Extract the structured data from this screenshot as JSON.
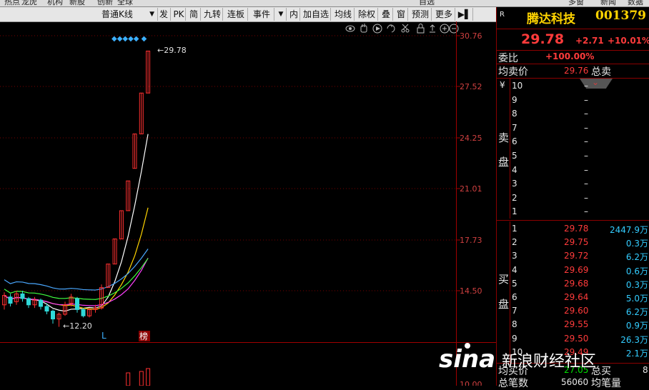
{
  "top_menu": [
    "热点",
    "龙虎",
    "机构",
    "新股",
    "创新",
    "全球",
    "",
    "",
    "",
    "",
    "",
    "",
    "自选",
    "",
    "",
    "",
    "",
    "",
    "",
    "多窗",
    "",
    "新闻",
    "",
    "数据"
  ],
  "toolbar": {
    "period_select": "普通K线",
    "buttons": [
      "发",
      "PK",
      "简",
      "九转",
      "连板",
      "事件",
      "内",
      "加自选",
      "均线",
      "除权",
      "叠",
      "窗",
      "预测",
      "更多"
    ]
  },
  "chart": {
    "y_ticks": [
      "30.76",
      "27.52",
      "24.25",
      "21.01",
      "17.73",
      "14.50"
    ],
    "bottom_tick": "10.00",
    "high_label": "29.78",
    "low_label": "12.20",
    "marker_L": "L",
    "marker_bang": "榜",
    "diamonds": "◆◆◆◆◆ ◆"
  },
  "candles": [
    {
      "o": 13.6,
      "c": 14.2,
      "h": 14.4,
      "l": 13.3
    },
    {
      "o": 14.1,
      "c": 13.7,
      "h": 14.3,
      "l": 13.5
    },
    {
      "o": 13.8,
      "c": 14.3,
      "h": 14.5,
      "l": 13.6
    },
    {
      "o": 14.3,
      "c": 14.0,
      "h": 14.5,
      "l": 13.8
    },
    {
      "o": 14.0,
      "c": 13.6,
      "h": 14.1,
      "l": 13.4
    },
    {
      "o": 13.6,
      "c": 13.9,
      "h": 14.1,
      "l": 13.4
    },
    {
      "o": 13.9,
      "c": 13.5,
      "h": 14.0,
      "l": 13.3
    },
    {
      "o": 13.5,
      "c": 13.2,
      "h": 13.7,
      "l": 13.0
    },
    {
      "o": 13.2,
      "c": 12.7,
      "h": 13.3,
      "l": 12.4
    },
    {
      "o": 12.7,
      "c": 13.0,
      "h": 13.1,
      "l": 12.2
    },
    {
      "o": 13.0,
      "c": 13.6,
      "h": 13.8,
      "l": 12.9
    },
    {
      "o": 13.7,
      "c": 14.1,
      "h": 14.3,
      "l": 13.5
    },
    {
      "o": 14.0,
      "c": 13.3,
      "h": 14.1,
      "l": 13.1
    },
    {
      "o": 13.3,
      "c": 12.9,
      "h": 13.4,
      "l": 12.8
    },
    {
      "o": 12.9,
      "c": 13.3,
      "h": 13.4,
      "l": 12.8
    },
    {
      "o": 13.3,
      "c": 13.4,
      "h": 13.6,
      "l": 13.1
    },
    {
      "o": 13.4,
      "c": 14.7,
      "h": 14.9,
      "l": 13.3
    },
    {
      "o": 14.7,
      "c": 16.2,
      "h": 16.2,
      "l": 14.7
    },
    {
      "o": 16.2,
      "c": 17.8,
      "h": 17.8,
      "l": 16.2
    },
    {
      "o": 17.8,
      "c": 19.6,
      "h": 19.6,
      "l": 17.8
    },
    {
      "o": 19.6,
      "c": 21.5,
      "h": 21.5,
      "l": 19.6
    },
    {
      "o": 22.3,
      "c": 24.5,
      "h": 24.5,
      "l": 22.3
    },
    {
      "o": 24.5,
      "c": 27.1,
      "h": 27.1,
      "l": 24.5
    },
    {
      "o": 27.1,
      "c": 29.78,
      "h": 29.78,
      "l": 27.1
    }
  ],
  "quote": {
    "r_label": "R",
    "name": "腾达科技",
    "code": "001379",
    "price": "29.78",
    "change": "+2.71",
    "change_pct": "+10.01%",
    "weibi_label": "委比",
    "weibi_value": "+100.00%",
    "avg_sell_label": "均卖价",
    "avg_sell_value": "29.76",
    "total_sell_label": "总卖",
    "sell_label_1": "卖",
    "sell_label_2": "盘",
    "yen": "¥",
    "sell_levels": [
      {
        "lvl": "10",
        "price": "–"
      },
      {
        "lvl": "9",
        "price": "–"
      },
      {
        "lvl": "8",
        "price": "–"
      },
      {
        "lvl": "7",
        "price": "–"
      },
      {
        "lvl": "6",
        "price": "–"
      },
      {
        "lvl": "5",
        "price": "–"
      },
      {
        "lvl": "4",
        "price": "–"
      },
      {
        "lvl": "3",
        "price": "–"
      },
      {
        "lvl": "2",
        "price": "–"
      },
      {
        "lvl": "1",
        "price": "–"
      }
    ],
    "buy_label_1": "买",
    "buy_label_2": "盘",
    "buy_levels": [
      {
        "lvl": "1",
        "price": "29.78",
        "vol": "2447.9万"
      },
      {
        "lvl": "2",
        "price": "29.75",
        "vol": "0.3万"
      },
      {
        "lvl": "3",
        "price": "29.72",
        "vol": "6.2万"
      },
      {
        "lvl": "4",
        "price": "29.69",
        "vol": "0.6万"
      },
      {
        "lvl": "5",
        "price": "29.68",
        "vol": "0.3万"
      },
      {
        "lvl": "6",
        "price": "29.64",
        "vol": "5.0万"
      },
      {
        "lvl": "7",
        "price": "29.60",
        "vol": "6.2万"
      },
      {
        "lvl": "8",
        "price": "29.55",
        "vol": "0.9万"
      },
      {
        "lvl": "9",
        "price": "29.50",
        "vol": "26.3万"
      },
      {
        "lvl": "10",
        "price": "29.49",
        "vol": "2.1万"
      }
    ],
    "avg_buy_label": "均买价",
    "avg_buy_value": "27.05",
    "total_buy_label": "总买",
    "total_buy_value": "8",
    "bishu_label": "总笔数",
    "bishu_value": "56060",
    "avg_vol_label": "均笔量"
  },
  "watermark": "新浪财经社区"
}
